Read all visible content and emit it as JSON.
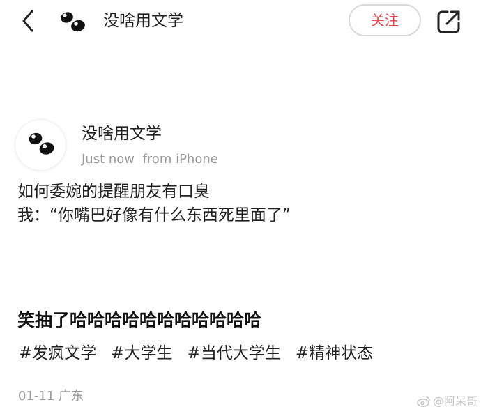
{
  "header": {
    "back_icon": "chevron-left-icon",
    "account_name": "没啥用文学",
    "follow_label": "关注",
    "follow_color": "#e5484d",
    "share_icon": "share-out-icon"
  },
  "post": {
    "author": "没啥用文学",
    "meta": "Just now  from iPhone",
    "lines": [
      "如何委婉的提醒朋友有口臭",
      "我：“你嘴巴好像有什么东西死里面了”"
    ],
    "caption": "笑抽了哈哈哈哈哈哈哈哈哈哈哈",
    "tags": [
      "#发疯文学",
      "#大学生",
      "#当代大学生",
      "#精神状态"
    ],
    "date_location": "01-11 广东",
    "watermark": "@阿呆哥"
  }
}
